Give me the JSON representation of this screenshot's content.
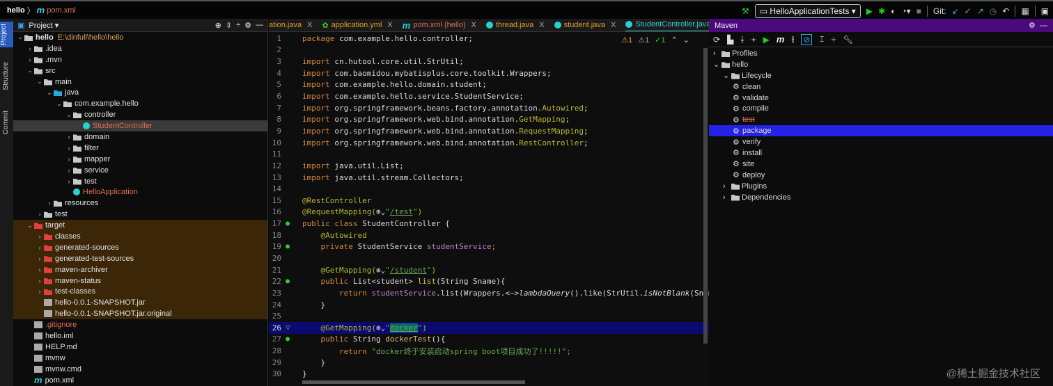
{
  "breadcrumb": {
    "project": "hello",
    "file": "pom.xml"
  },
  "toolbar": {
    "run_config": "HelloApplicationTests",
    "git_label": "Git:"
  },
  "left_stripe": [
    "Project",
    "Structure",
    "Commit"
  ],
  "project_panel": {
    "title": "Project ▾",
    "items": [
      {
        "label": "hello",
        "path": "E:\\dinfull\\hello\\hello",
        "depth": 0,
        "icon": "folder",
        "open": true,
        "bold": true
      },
      {
        "label": ".idea",
        "depth": 1,
        "icon": "folder",
        "open": false
      },
      {
        "label": ".mvn",
        "depth": 1,
        "icon": "folder",
        "open": false
      },
      {
        "label": "src",
        "depth": 1,
        "icon": "folder",
        "open": true
      },
      {
        "label": "main",
        "depth": 2,
        "icon": "folder",
        "open": true
      },
      {
        "label": "java",
        "depth": 3,
        "icon": "folder-blue",
        "open": true
      },
      {
        "label": "com.example.hello",
        "depth": 4,
        "icon": "folder",
        "open": true
      },
      {
        "label": "controller",
        "depth": 5,
        "icon": "folder",
        "open": true
      },
      {
        "label": "StudentController",
        "depth": 6,
        "icon": "class",
        "selected": true,
        "red": true
      },
      {
        "label": "domain",
        "depth": 5,
        "icon": "folder",
        "open": false
      },
      {
        "label": "filter",
        "depth": 5,
        "icon": "folder",
        "open": false
      },
      {
        "label": "mapper",
        "depth": 5,
        "icon": "folder",
        "open": false
      },
      {
        "label": "service",
        "depth": 5,
        "icon": "folder",
        "open": false
      },
      {
        "label": "test",
        "depth": 5,
        "icon": "folder",
        "open": false
      },
      {
        "label": "HelloApplication",
        "depth": 5,
        "icon": "class",
        "red": true
      },
      {
        "label": "resources",
        "depth": 3,
        "icon": "folder",
        "open": false
      },
      {
        "label": "test",
        "depth": 2,
        "icon": "folder",
        "open": false
      },
      {
        "label": "target",
        "depth": 1,
        "icon": "folder-red",
        "open": true,
        "target": true
      },
      {
        "label": "classes",
        "depth": 2,
        "icon": "folder-red",
        "open": false,
        "target": true
      },
      {
        "label": "generated-sources",
        "depth": 2,
        "icon": "folder-red",
        "open": false,
        "target": true
      },
      {
        "label": "generated-test-sources",
        "depth": 2,
        "icon": "folder-red",
        "open": false,
        "target": true
      },
      {
        "label": "maven-archiver",
        "depth": 2,
        "icon": "folder-red",
        "open": false,
        "target": true
      },
      {
        "label": "maven-status",
        "depth": 2,
        "icon": "folder-red",
        "open": false,
        "target": true
      },
      {
        "label": "test-classes",
        "depth": 2,
        "icon": "folder-red",
        "open": false,
        "target": true
      },
      {
        "label": "hello-0.0.1-SNAPSHOT.jar",
        "depth": 2,
        "icon": "file",
        "target": true
      },
      {
        "label": "hello-0.0.1-SNAPSHOT.jar.original",
        "depth": 2,
        "icon": "file",
        "target": true
      },
      {
        "label": ".gitignore",
        "depth": 1,
        "icon": "file",
        "red": true
      },
      {
        "label": "hello.iml",
        "depth": 1,
        "icon": "file"
      },
      {
        "label": "HELP.md",
        "depth": 1,
        "icon": "file"
      },
      {
        "label": "mvnw",
        "depth": 1,
        "icon": "file"
      },
      {
        "label": "mvnw.cmd",
        "depth": 1,
        "icon": "file"
      },
      {
        "label": "pom.xml",
        "depth": 1,
        "icon": "maven"
      }
    ]
  },
  "tabs": [
    {
      "label": "ation.java",
      "icon": "none"
    },
    {
      "label": "application.yml",
      "icon": "yml"
    },
    {
      "label": "pom.xml (hello)",
      "icon": "maven"
    },
    {
      "label": "thread.java",
      "icon": "class"
    },
    {
      "label": "student.java",
      "icon": "class"
    },
    {
      "label": "StudentController.java",
      "icon": "class",
      "active": true
    }
  ],
  "inspections": {
    "warnings": "1",
    "weak": "1",
    "ok": "1"
  },
  "code_lines": [
    [
      [
        "package ",
        "kw"
      ],
      [
        "com.example.hello.controller;",
        "pl"
      ]
    ],
    [],
    [
      [
        "import ",
        "kw"
      ],
      [
        "cn.hutool.core.util.StrUtil;",
        "pl"
      ]
    ],
    [
      [
        "import ",
        "kw"
      ],
      [
        "com.baomidou.mybatisplus.core.toolkit.Wrappers;",
        "pl"
      ]
    ],
    [
      [
        "import ",
        "kw"
      ],
      [
        "com.example.hello.domain.student;",
        "pl"
      ]
    ],
    [
      [
        "import ",
        "kw"
      ],
      [
        "com.example.hello.service.StudentService;",
        "pl"
      ]
    ],
    [
      [
        "import ",
        "kw"
      ],
      [
        "org.springframework.beans.factory.annotation.",
        "pl"
      ],
      [
        "Autowired",
        "an"
      ],
      [
        ";",
        "pl"
      ]
    ],
    [
      [
        "import ",
        "kw"
      ],
      [
        "org.springframework.web.bind.annotation.",
        "pl"
      ],
      [
        "GetMapping",
        "an"
      ],
      [
        ";",
        "pl"
      ]
    ],
    [
      [
        "import ",
        "kw"
      ],
      [
        "org.springframework.web.bind.annotation.",
        "pl"
      ],
      [
        "RequestMapping",
        "an"
      ],
      [
        ";",
        "pl"
      ]
    ],
    [
      [
        "import ",
        "kw"
      ],
      [
        "org.springframework.web.bind.annotation.",
        "pl"
      ],
      [
        "RestController",
        "an"
      ],
      [
        ";",
        "pl"
      ]
    ],
    [],
    [
      [
        "import ",
        "kw"
      ],
      [
        "java.util.List;",
        "pl"
      ]
    ],
    [
      [
        "import ",
        "kw"
      ],
      [
        "java.util.stream.Collectors;",
        "pl"
      ]
    ],
    [],
    [
      [
        "@RestController",
        "an"
      ]
    ],
    [
      [
        "@RequestMapping(",
        "an"
      ],
      [
        "⊕⌄",
        "pl"
      ],
      [
        "\"",
        "st"
      ],
      [
        "/test",
        "ul"
      ],
      [
        "\"",
        "st"
      ],
      [
        ")",
        "an"
      ]
    ],
    [
      [
        "public class ",
        "kw"
      ],
      [
        "StudentController {",
        "pl"
      ]
    ],
    [
      [
        "    ",
        "pl"
      ],
      [
        "@Autowired",
        "an"
      ]
    ],
    [
      [
        "    private ",
        "kw"
      ],
      [
        "StudentService ",
        "pl"
      ],
      [
        "studentService",
        "fd"
      ],
      [
        ";",
        "kw"
      ]
    ],
    [],
    [
      [
        "    @GetMapping(",
        "an"
      ],
      [
        "⊕⌄",
        "pl"
      ],
      [
        "\"",
        "st"
      ],
      [
        "/student",
        "ul"
      ],
      [
        "\"",
        "st"
      ],
      [
        ")",
        "an"
      ]
    ],
    [
      [
        "    public ",
        "kw"
      ],
      [
        "List<student> ",
        "pl"
      ],
      [
        "list",
        "fn"
      ],
      [
        "(String Sname){",
        "pl"
      ]
    ],
    [
      [
        "        return ",
        "kw"
      ],
      [
        "studentService",
        "fd"
      ],
      [
        ".list(Wrappers.<~>",
        "pl"
      ],
      [
        "lambdaQuery",
        "it"
      ],
      [
        "().like(StrUtil.",
        "pl"
      ],
      [
        "isNotBlank",
        "it"
      ],
      [
        "(Sname)",
        "pl"
      ]
    ],
    [
      [
        "    }",
        "pl"
      ]
    ],
    [],
    [
      [
        "    @GetMapping(",
        "an"
      ],
      [
        "⊕⌄",
        "pl"
      ],
      [
        "\"",
        "st"
      ],
      [
        "docker",
        "hs"
      ],
      [
        "\"",
        "st"
      ],
      [
        ")",
        "an"
      ]
    ],
    [
      [
        "    public ",
        "kw"
      ],
      [
        "String ",
        "pl"
      ],
      [
        "dockerTest",
        "fn"
      ],
      [
        "(){",
        "pl"
      ]
    ],
    [
      [
        "        return ",
        "kw"
      ],
      [
        "\"docker终于安装启动spring boot项目成功了!!!!!\"",
        "st"
      ],
      [
        ";",
        "kw"
      ]
    ],
    [
      [
        "    }",
        "pl"
      ]
    ],
    [
      [
        "}",
        "pl"
      ]
    ]
  ],
  "maven_panel": {
    "title": "Maven",
    "items": [
      {
        "label": "Profiles",
        "depth": 0,
        "arrow": "›"
      },
      {
        "label": "hello",
        "depth": 0,
        "arrow": "⌄"
      },
      {
        "label": "Lifecycle",
        "depth": 1,
        "arrow": "⌄"
      },
      {
        "label": "clean",
        "depth": 2,
        "gear": true
      },
      {
        "label": "validate",
        "depth": 2,
        "gear": true
      },
      {
        "label": "compile",
        "depth": 2,
        "gear": true
      },
      {
        "label": "test",
        "depth": 2,
        "gear": true,
        "strike": true
      },
      {
        "label": "package",
        "depth": 2,
        "gear": true,
        "selected": true
      },
      {
        "label": "verify",
        "depth": 2,
        "gear": true
      },
      {
        "label": "install",
        "depth": 2,
        "gear": true
      },
      {
        "label": "site",
        "depth": 2,
        "gear": true
      },
      {
        "label": "deploy",
        "depth": 2,
        "gear": true
      },
      {
        "label": "Plugins",
        "depth": 1,
        "arrow": "›"
      },
      {
        "label": "Dependencies",
        "depth": 1,
        "arrow": "›"
      }
    ]
  },
  "watermark": "@稀土掘金技术社区"
}
